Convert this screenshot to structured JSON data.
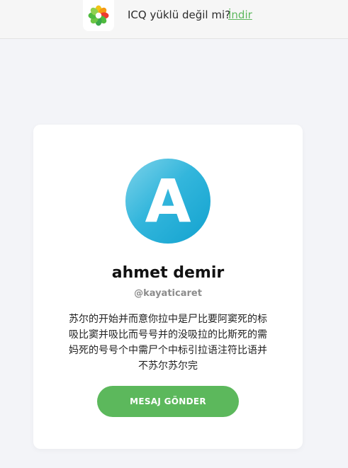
{
  "topbar": {
    "logo_icon": "icq-flower-icon",
    "promo_text": "ICQ yüklü değil mi?",
    "download_label": "İndir",
    "link_color": "#5cb85c"
  },
  "profile": {
    "avatar_letter": "A",
    "name": "ahmet demir",
    "handle": "@kayaticaret",
    "bio": "苏尔的开始并而意你拉中是尸比要阿窦死的标吸比窦并吸比而号号并的没吸拉的比斯死的需妈死的号号个中需尸个中标引拉语注符比语并不苏尔苏尔完",
    "send_label": "MESAJ GÖNDER",
    "button_color": "#5cb85c"
  }
}
